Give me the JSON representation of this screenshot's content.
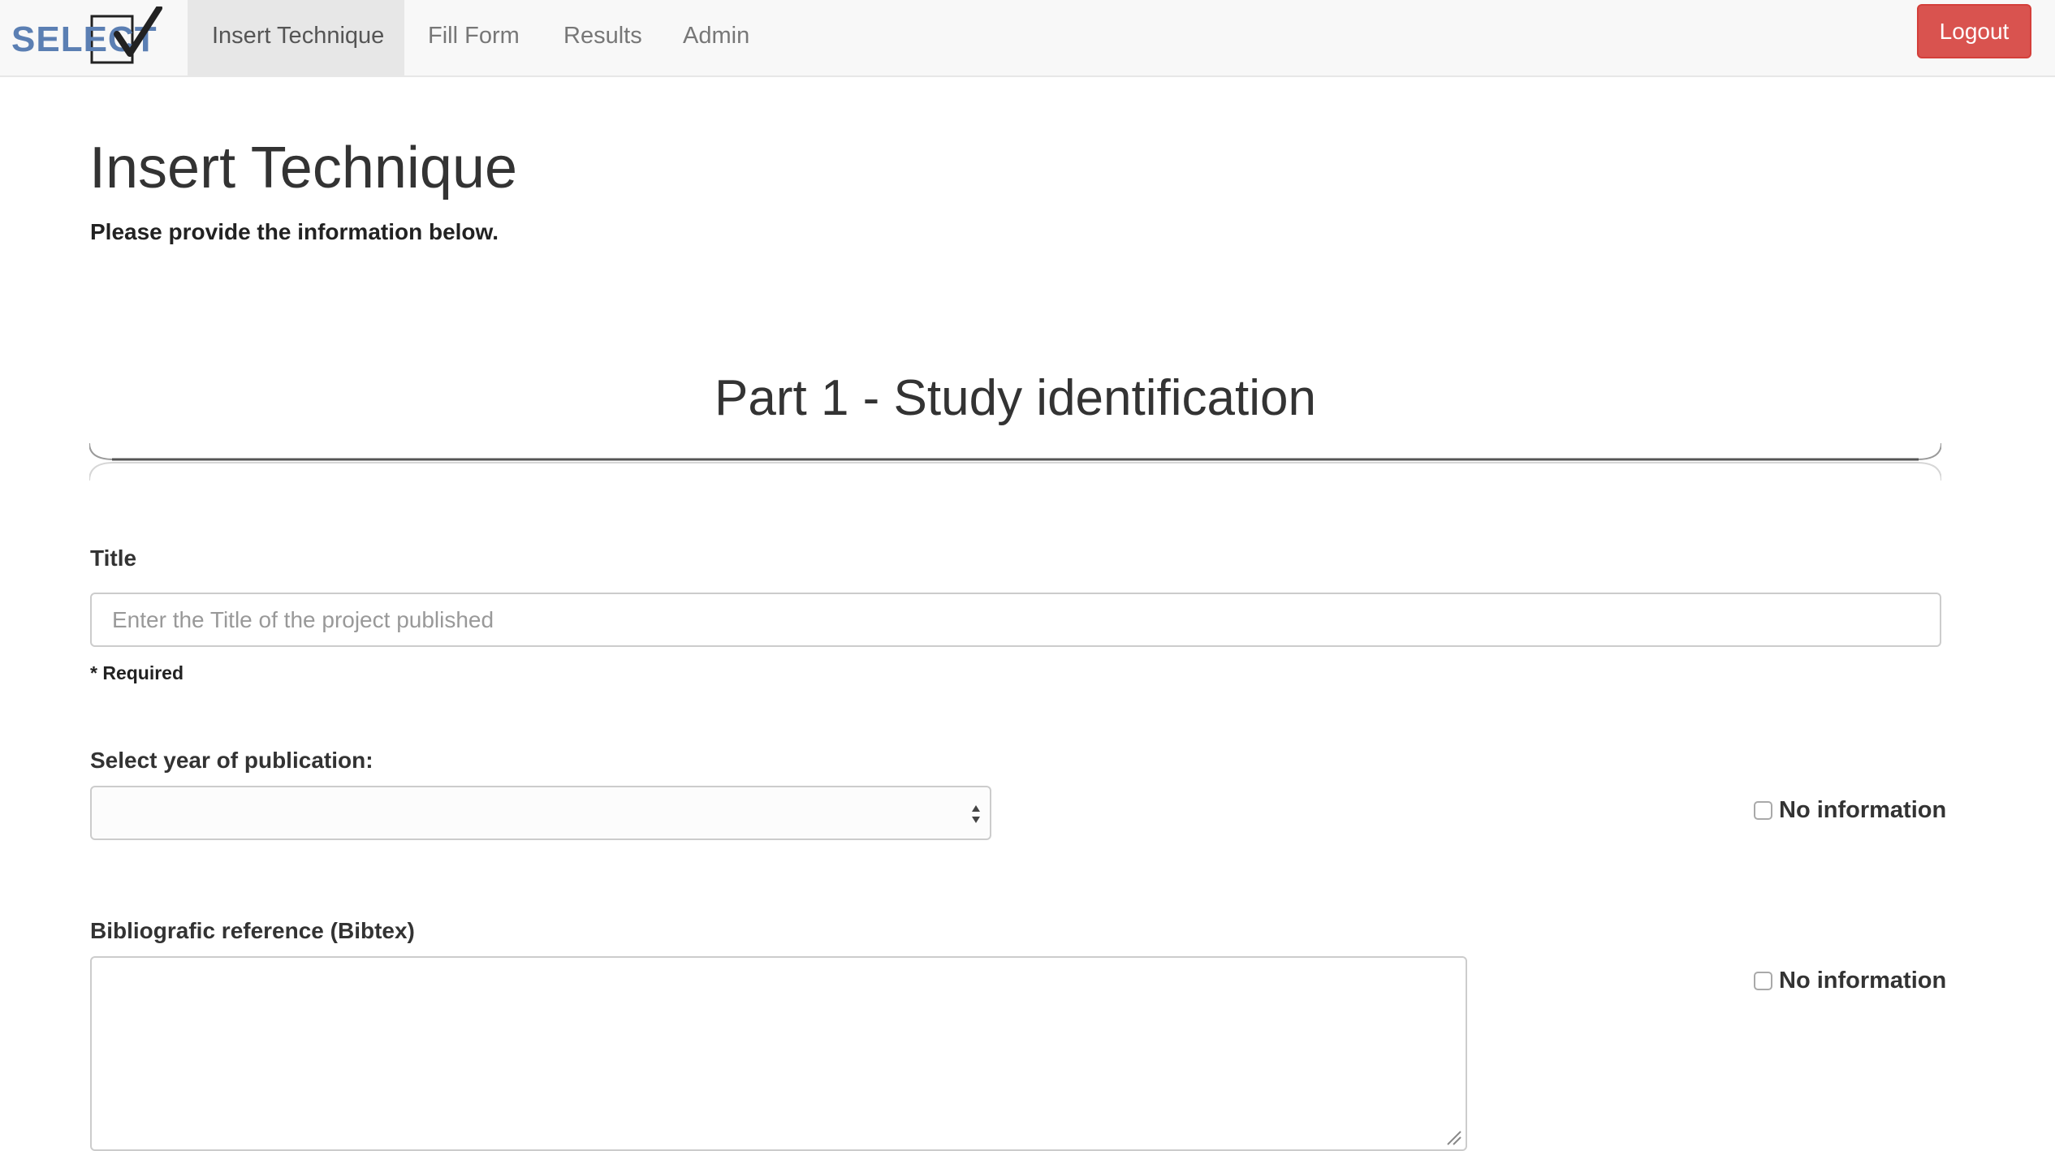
{
  "brand": {
    "logo_text": "SELECT",
    "logo_color": "#5b7fb3"
  },
  "nav": {
    "items": [
      {
        "label": "Insert Technique",
        "active": true
      },
      {
        "label": "Fill Form",
        "active": false
      },
      {
        "label": "Results",
        "active": false
      },
      {
        "label": "Admin",
        "active": false
      }
    ],
    "logout_label": "Logout",
    "logout_color": "#d9534f"
  },
  "header": {
    "title": "Insert Technique",
    "subtitle": "Please provide the information below."
  },
  "section": {
    "title": "Part 1 - Study identification"
  },
  "form": {
    "title_label": "Title",
    "title_placeholder": "Enter the Title of the project published",
    "title_value": "",
    "required_note": "* Required",
    "year_label": "Select year of publication:",
    "year_selected": "",
    "bib_label": "Bibliografic reference (Bibtex)",
    "bib_value": "",
    "no_info_label": "No information",
    "year_no_info_checked": false,
    "bib_no_info_checked": false
  }
}
